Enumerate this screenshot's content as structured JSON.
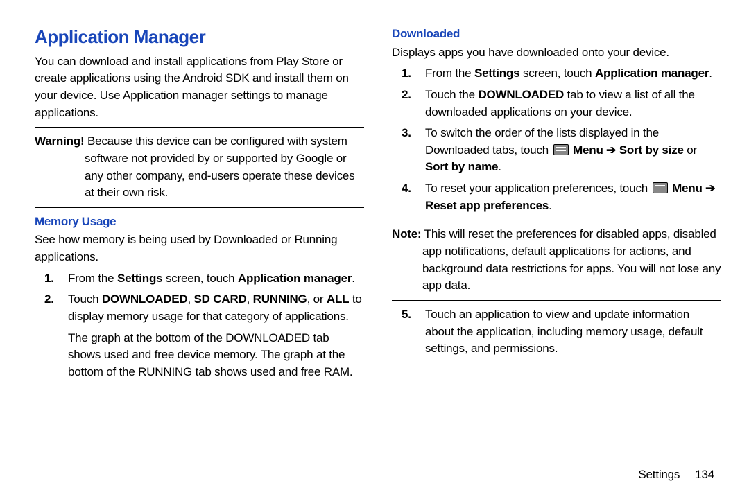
{
  "left": {
    "h1": "Application Manager",
    "intro": "You can download and install applications from Play Store or create applications using the Android SDK and install them on your device. Use Application manager settings to manage applications.",
    "warning_label": "Warning!",
    "warning_text": " Because this device can be configured with system software not provided by or supported by Google or any other company, end-users operate these devices at their own risk.",
    "mem_h2": "Memory Usage",
    "mem_intro": "See how memory is being used by Downloaded or Running applications.",
    "mem_s1_a": "From the ",
    "mem_s1_b": "Settings",
    "mem_s1_c": " screen, touch ",
    "mem_s1_d": "Application manager",
    "mem_s1_e": ".",
    "mem_s2_a": "Touch ",
    "mem_s2_b": "DOWNLOADED",
    "mem_s2_c": ", ",
    "mem_s2_d": "SD CARD",
    "mem_s2_e": ", ",
    "mem_s2_f": "RUNNING",
    "mem_s2_g": ", or ",
    "mem_s2_h": "ALL",
    "mem_s2_i": " to display memory usage for that category of applications.",
    "mem_s2_sub": "The graph at the bottom of the DOWNLOADED tab shows used and free device memory. The graph at the bottom of the RUNNING tab shows used and free RAM."
  },
  "right": {
    "dl_h2": "Downloaded",
    "dl_intro": "Displays apps you have downloaded onto your device.",
    "dl_s1_a": "From the ",
    "dl_s1_b": "Settings",
    "dl_s1_c": " screen, touch ",
    "dl_s1_d": "Application manager",
    "dl_s1_e": ".",
    "dl_s2_a": "Touch the ",
    "dl_s2_b": "DOWNLOADED",
    "dl_s2_c": " tab to view a list of all the downloaded applications on your device.",
    "dl_s3_a": "To switch the order of the lists displayed in the Downloaded tabs, touch ",
    "dl_s3_menu": "Menu",
    "dl_s3_arrow": " ➔ ",
    "dl_s3_b": "Sort by size",
    "dl_s3_c": " or ",
    "dl_s3_d": "Sort by name",
    "dl_s3_e": ".",
    "dl_s4_a": "To reset your application preferences, touch ",
    "dl_s4_menu": "Menu",
    "dl_s4_arrow": " ➔ ",
    "dl_s4_b": "Reset app preferences",
    "dl_s4_c": ".",
    "note_label": "Note:",
    "note_text": " This will reset the preferences for disabled apps, disabled app notifications, default applications for actions, and background data restrictions for apps. You will not lose any app data.",
    "dl_s5": "Touch an application to view and update information about the application, including memory usage, default settings, and permissions."
  },
  "footer_section": "Settings",
  "footer_page": "134"
}
